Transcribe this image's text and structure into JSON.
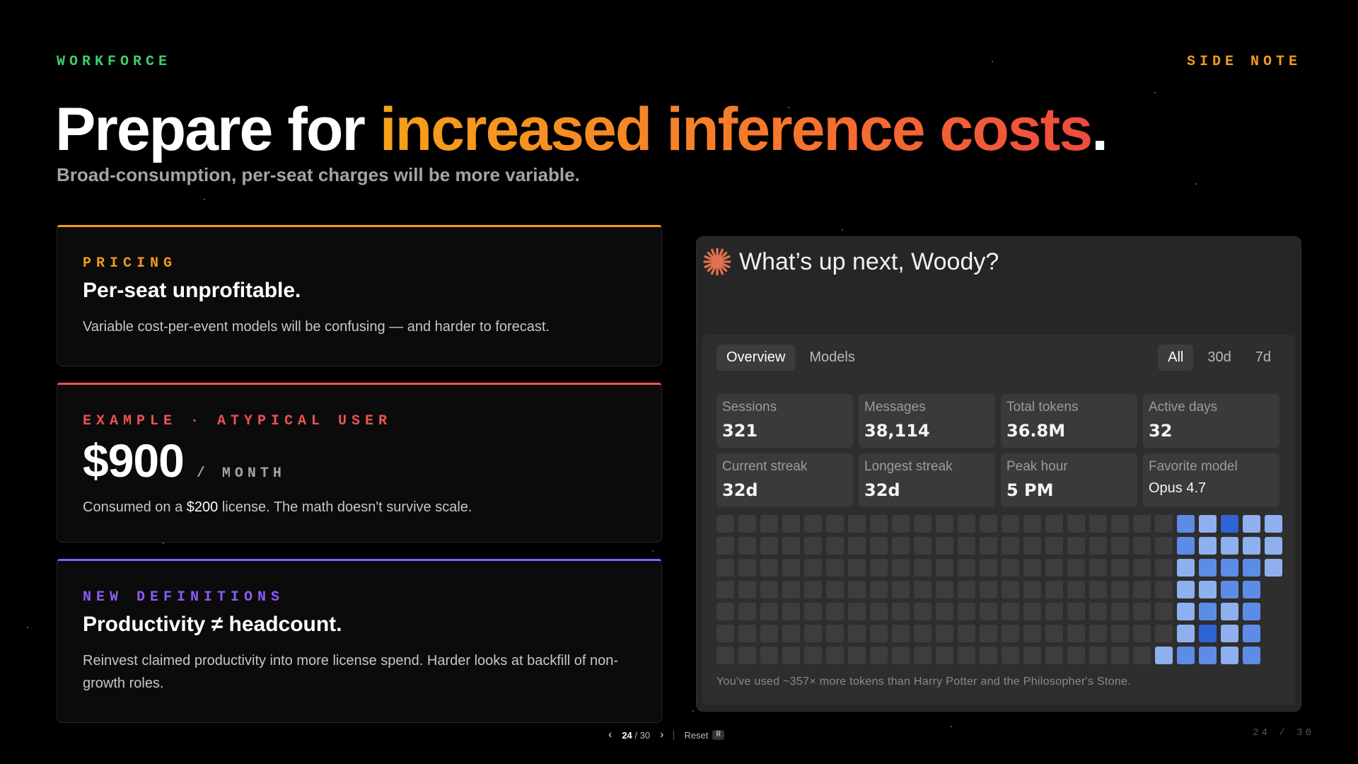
{
  "eyebrow_left": "WORKFORCE",
  "eyebrow_right": "SIDE NOTE",
  "headline": {
    "prefix": "Prepare for ",
    "accent": "increased inference costs",
    "suffix": "."
  },
  "subhead": "Broad-consumption, per-seat charges will be more variable.",
  "cards": {
    "pricing": {
      "label": "PRICING",
      "title": "Per-seat unprofitable.",
      "desc": "Variable cost-per-event models will be confusing — and harder to forecast.",
      "accent_color": "#f29a1d"
    },
    "example": {
      "label": "EXAMPLE · ATYPICAL USER",
      "price": "$900",
      "per": "/ MONTH",
      "desc_prefix": "Consumed on a ",
      "desc_highlight": "$200",
      "desc_suffix": " license. The math doesn't survive scale.",
      "accent_color": "#ef5350"
    },
    "definitions": {
      "label": "NEW DEFINITIONS",
      "title": "Productivity ≠ headcount.",
      "desc": "Reinvest claimed productivity into more license spend. Harder looks at backfill of non-growth roles.",
      "accent_color": "#8b5cf6"
    }
  },
  "app": {
    "greeting": "What’s up next, Woody?",
    "tabs": [
      "Overview",
      "Models"
    ],
    "active_tab": "Overview",
    "ranges": [
      "All",
      "30d",
      "7d"
    ],
    "active_range": "All",
    "stats": [
      {
        "key": "Sessions",
        "value": "321"
      },
      {
        "key": "Messages",
        "value": "38,114"
      },
      {
        "key": "Total tokens",
        "value": "36.8M"
      },
      {
        "key": "Active days",
        "value": "32"
      },
      {
        "key": "Current streak",
        "value": "32d"
      },
      {
        "key": "Longest streak",
        "value": "32d"
      },
      {
        "key": "Peak hour",
        "value": "5 PM"
      },
      {
        "key": "Favorite model",
        "value": "Opus 4.7"
      }
    ],
    "heatmap": {
      "rows": 7,
      "cols": 26,
      "colors": {
        "empty": "#3d3d3d",
        "light": "#8fb0ef",
        "mid": "#5d8ce6",
        "dark": "#2f64d6"
      },
      "active": [
        [
          "",
          "",
          "",
          "",
          "",
          "",
          "",
          "",
          "",
          "",
          "",
          "",
          "",
          "",
          "",
          "",
          "",
          "",
          "",
          "",
          "",
          "mid",
          "light",
          "dark",
          "light",
          "light"
        ],
        [
          "",
          "",
          "",
          "",
          "",
          "",
          "",
          "",
          "",
          "",
          "",
          "",
          "",
          "",
          "",
          "",
          "",
          "",
          "",
          "",
          "",
          "mid",
          "light",
          "light",
          "light",
          "light"
        ],
        [
          "",
          "",
          "",
          "",
          "",
          "",
          "",
          "",
          "",
          "",
          "",
          "",
          "",
          "",
          "",
          "",
          "",
          "",
          "",
          "",
          "",
          "light",
          "mid",
          "mid",
          "mid",
          "light"
        ],
        [
          "",
          "",
          "",
          "",
          "",
          "",
          "",
          "",
          "",
          "",
          "",
          "",
          "",
          "",
          "",
          "",
          "",
          "",
          "",
          "",
          "",
          "light",
          "light",
          "mid",
          "mid",
          "none"
        ],
        [
          "",
          "",
          "",
          "",
          "",
          "",
          "",
          "",
          "",
          "",
          "",
          "",
          "",
          "",
          "",
          "",
          "",
          "",
          "",
          "",
          "",
          "light",
          "mid",
          "light",
          "mid",
          "none"
        ],
        [
          "",
          "",
          "",
          "",
          "",
          "",
          "",
          "",
          "",
          "",
          "",
          "",
          "",
          "",
          "",
          "",
          "",
          "",
          "",
          "",
          "",
          "light",
          "dark",
          "light",
          "mid",
          "none"
        ],
        [
          "",
          "",
          "",
          "",
          "",
          "",
          "",
          "",
          "",
          "",
          "",
          "",
          "",
          "",
          "",
          "",
          "",
          "",
          "",
          "",
          "light",
          "mid",
          "mid",
          "light",
          "mid",
          "none"
        ]
      ]
    },
    "footnote": "You've used ~357× more tokens than Harry Potter and the Philosopher's Stone."
  },
  "nav": {
    "current": "24",
    "total_label": "/ 30",
    "reset_label": "Reset",
    "reset_key": "R"
  },
  "page_indicator": "24 / 30"
}
